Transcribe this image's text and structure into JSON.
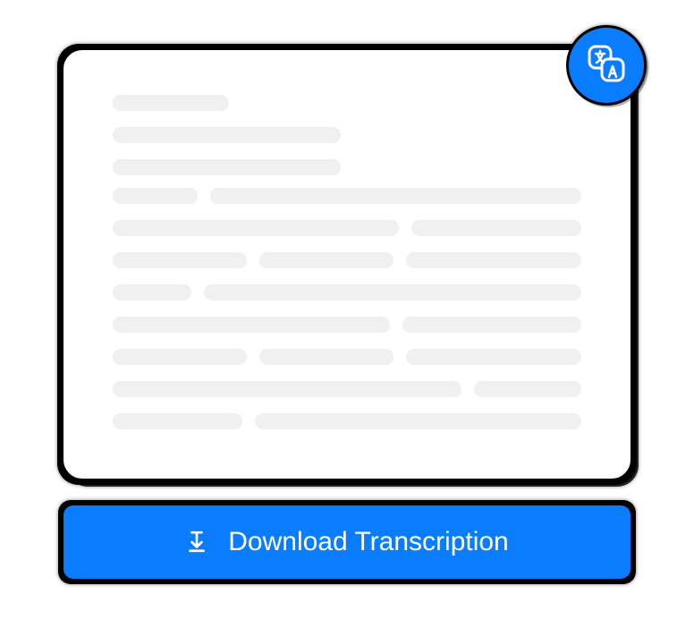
{
  "colors": {
    "accent": "#0a7cff",
    "skeleton": "#f0f0f0",
    "border": "#000000",
    "white": "#ffffff"
  },
  "badge": {
    "icon_name": "translate-icon"
  },
  "button": {
    "label": "Download Transcription",
    "icon_name": "download-to-line-icon"
  }
}
